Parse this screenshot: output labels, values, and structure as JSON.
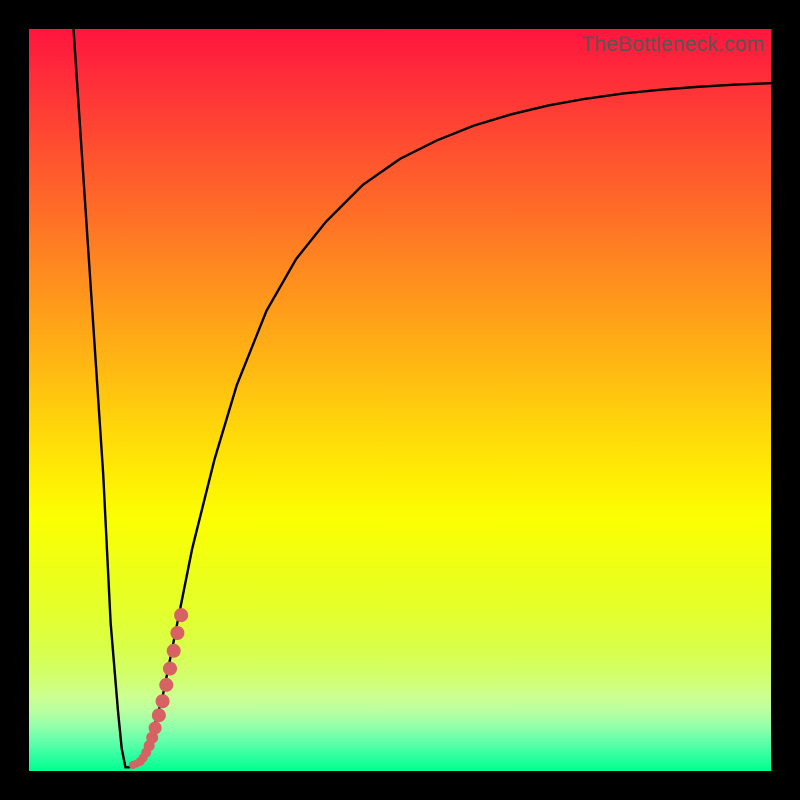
{
  "watermark": "TheBottleneck.com",
  "colors": {
    "frame": "#000000",
    "curve_stroke": "#000000",
    "marker_fill": "#d66263",
    "marker_stroke": "#bb4a4c"
  },
  "chart_data": {
    "type": "line",
    "title": "",
    "xlabel": "",
    "ylabel": "",
    "xlim": [
      0,
      100
    ],
    "ylim": [
      0,
      100
    ],
    "grid": false,
    "series": [
      {
        "name": "bottleneck-curve",
        "x": [
          6,
          8,
          10,
          11,
          12,
          12.5,
          13,
          13.5,
          14,
          15,
          16,
          18,
          20,
          22,
          25,
          28,
          32,
          36,
          40,
          45,
          50,
          55,
          60,
          65,
          70,
          75,
          80,
          85,
          90,
          95,
          100
        ],
        "y": [
          100,
          70,
          40,
          20,
          8,
          3,
          0.5,
          0.5,
          0.8,
          1.3,
          3,
          10,
          20,
          30,
          42,
          52,
          62,
          69,
          74,
          79,
          82.5,
          85,
          87,
          88.5,
          89.7,
          90.6,
          91.3,
          91.8,
          92.2,
          92.5,
          92.7
        ]
      }
    ],
    "markers": {
      "name": "highlighted-segment",
      "points": [
        {
          "x": 14.0,
          "y": 0.8,
          "r": 4
        },
        {
          "x": 14.5,
          "y": 1.0,
          "r": 4
        },
        {
          "x": 15.0,
          "y": 1.3,
          "r": 4.5
        },
        {
          "x": 15.4,
          "y": 1.8,
          "r": 4.5
        },
        {
          "x": 15.8,
          "y": 2.5,
          "r": 5
        },
        {
          "x": 16.2,
          "y": 3.4,
          "r": 5.5
        },
        {
          "x": 16.6,
          "y": 4.5,
          "r": 6
        },
        {
          "x": 17.0,
          "y": 5.8,
          "r": 6.5
        },
        {
          "x": 17.5,
          "y": 7.5,
          "r": 7
        },
        {
          "x": 18.0,
          "y": 9.4,
          "r": 7
        },
        {
          "x": 18.5,
          "y": 11.6,
          "r": 7
        },
        {
          "x": 19.0,
          "y": 13.8,
          "r": 7
        },
        {
          "x": 19.5,
          "y": 16.2,
          "r": 7
        },
        {
          "x": 20.0,
          "y": 18.6,
          "r": 7
        },
        {
          "x": 20.5,
          "y": 21.0,
          "r": 7
        }
      ]
    }
  }
}
